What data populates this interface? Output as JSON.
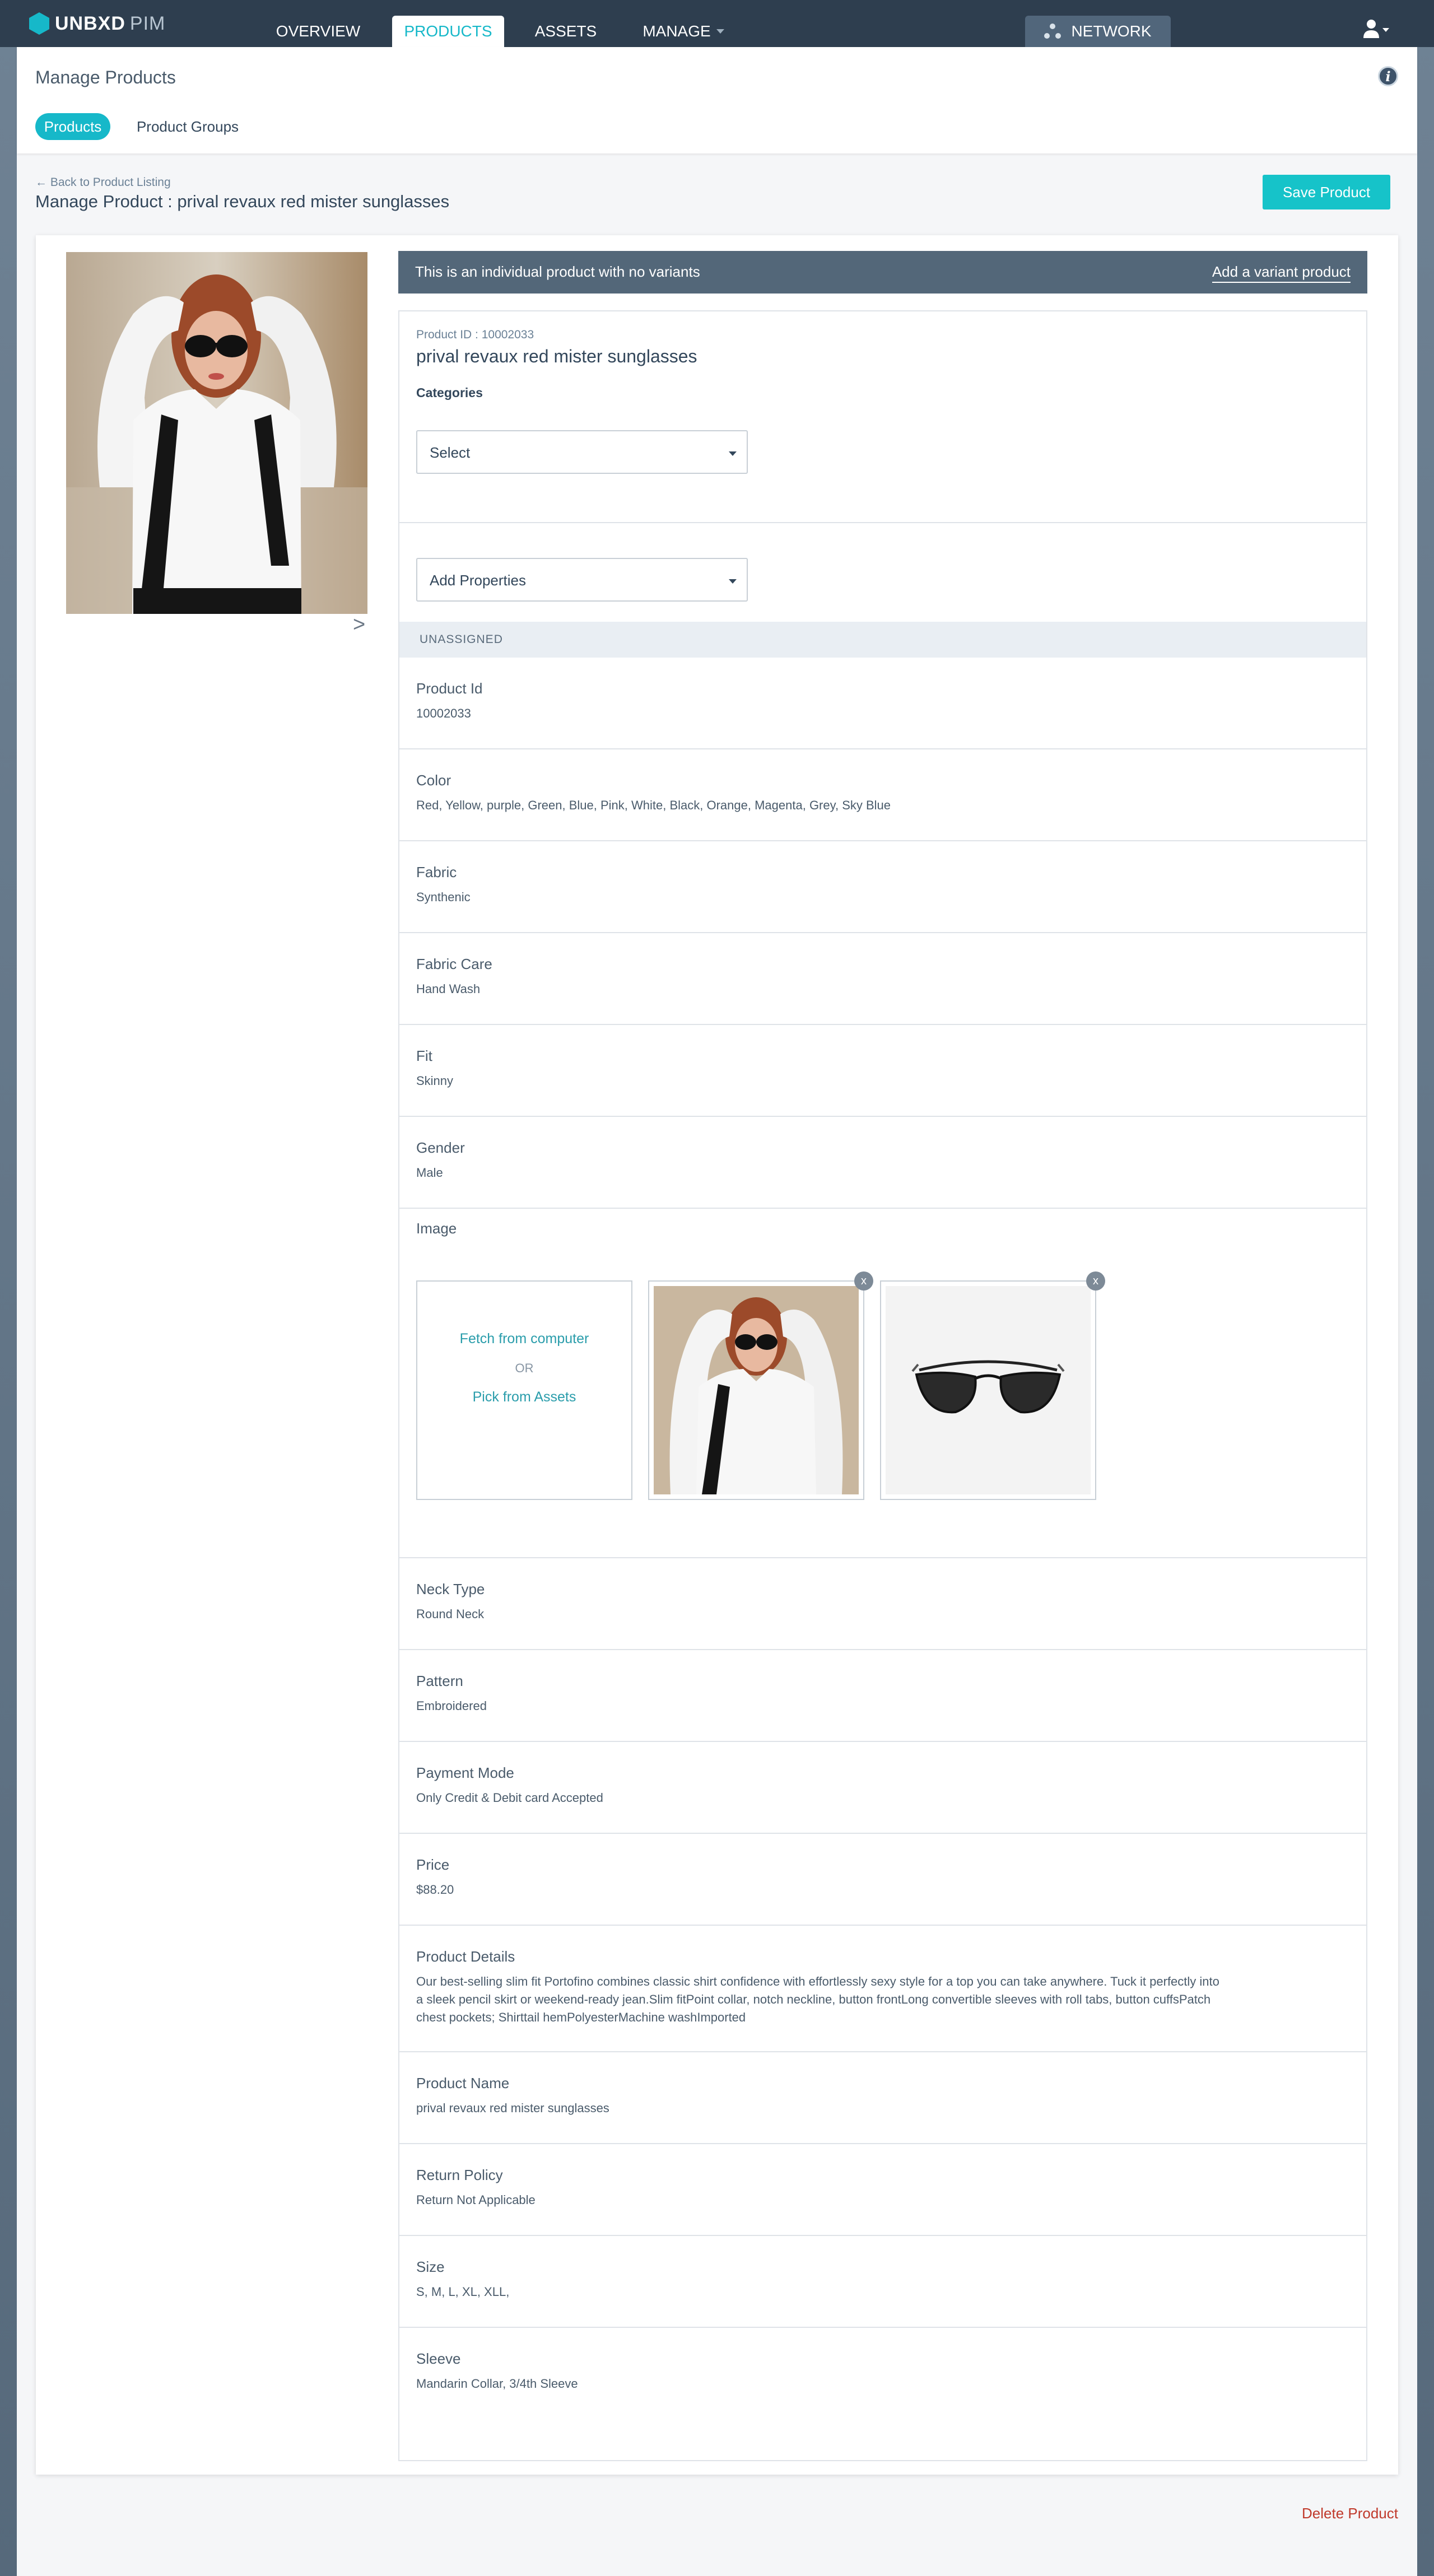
{
  "app": {
    "brand": "UNBXD",
    "product": "PIM"
  },
  "nav": {
    "tabs": [
      "OVERVIEW",
      "PRODUCTS",
      "ASSETS",
      "MANAGE"
    ],
    "active": "PRODUCTS",
    "network_label": "NETWORK"
  },
  "header": {
    "title": "Manage Products",
    "subtabs": [
      "Products",
      "Product Groups"
    ]
  },
  "product": {
    "back_label": "Back to Product Listing",
    "heading": "Manage Product : prival revaux red mister sunglasses",
    "save_label": "Save Product",
    "variant_message": "This is an individual product with no variants",
    "add_variant_label": "Add a variant product",
    "id_line": "Product ID : 10002033",
    "name": "prival revaux red mister sunglasses",
    "categories_label": "Categories",
    "categories_placeholder": "Select",
    "add_properties_placeholder": "Add Properties",
    "unassigned_label": "UNASSIGNED",
    "delete_label": "Delete Product"
  },
  "image_upload": {
    "label": "Image",
    "fetch": "Fetch from computer",
    "or": "OR",
    "pick": "Pick from Assets",
    "remove": "x"
  },
  "properties": [
    {
      "label": "Product Id",
      "value": "10002033"
    },
    {
      "label": "Color",
      "value": "Red, Yellow, purple, Green, Blue, Pink, White, Black, Orange, Magenta, Grey, Sky Blue"
    },
    {
      "label": "Fabric",
      "value": "Synthenic"
    },
    {
      "label": "Fabric Care",
      "value": "Hand Wash"
    },
    {
      "label": "Fit",
      "value": "Skinny"
    },
    {
      "label": "Gender",
      "value": "Male"
    },
    {
      "label": "Neck Type",
      "value": "Round Neck"
    },
    {
      "label": "Pattern",
      "value": "Embroidered"
    },
    {
      "label": "Payment Mode",
      "value": "Only Credit & Debit card Accepted"
    },
    {
      "label": "Price",
      "value": "$88.20"
    },
    {
      "label": "Product Details",
      "value": "Our best-selling slim fit Portofino combines classic shirt confidence with effortlessly sexy style for a top you can take anywhere. Tuck it perfectly into a sleek pencil skirt or weekend-ready jean.Slim fitPoint collar, notch neckline, button frontLong convertible sleeves with roll tabs, button cuffsPatch chest pockets; Shirttail hemPolyesterMachine washImported"
    },
    {
      "label": "Product Name",
      "value": "prival revaux red mister sunglasses"
    },
    {
      "label": "Return Policy",
      "value": "Return Not Applicable"
    },
    {
      "label": "Size",
      "value": "S, M, L, XL, XLL,"
    },
    {
      "label": "Sleeve",
      "value": "Mandarin Collar, 3/4th Sleeve"
    }
  ],
  "colors": {
    "accent": "#16b8c9",
    "nav": "#2e3e4f",
    "variant_bar": "#536779",
    "danger": "#c0392b"
  }
}
